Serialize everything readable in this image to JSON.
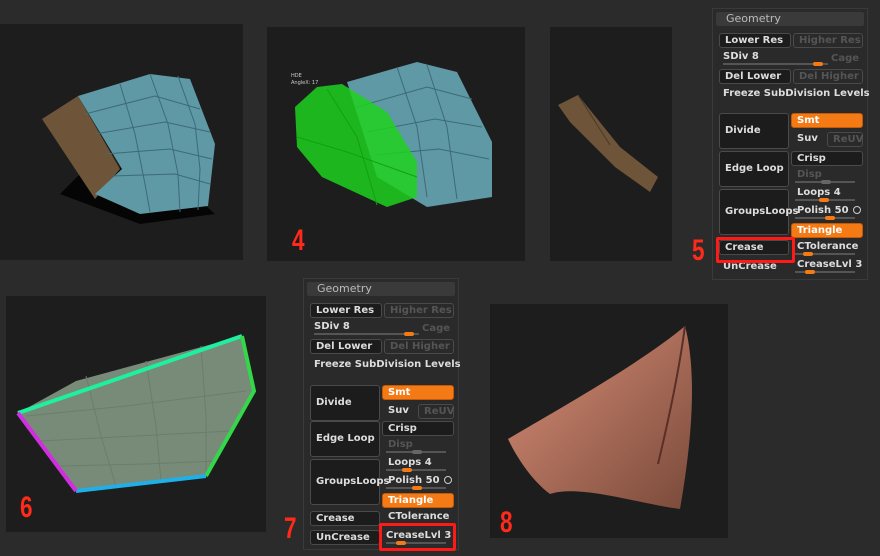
{
  "markers": {
    "n4": "4",
    "n5": "5",
    "n6": "6",
    "n7": "7",
    "n8": "8"
  },
  "overlay_text": {
    "line1": "HDE",
    "line2": "AngleX: 17"
  },
  "geometry": {
    "title": "Geometry",
    "lower_res": "Lower Res",
    "higher_res": "Higher Res",
    "sdiv": "SDiv 8",
    "cage": "Cage",
    "del_lower": "Del Lower",
    "del_higher": "Del Higher",
    "freeze": "Freeze SubDivision Levels",
    "divide": "Divide",
    "smt": "Smt",
    "suv": "Suv",
    "reuv": "ReUV",
    "edge_loop": "Edge Loop",
    "crisp": "Crisp",
    "disp": "Disp",
    "groups_loops": "GroupsLoops",
    "loops": "Loops 4",
    "polish": "Polish 50",
    "triangle": "Triangle",
    "crease": "Crease",
    "ctolerance": "CTolerance",
    "uncrease": "UnCrease",
    "crease_lvl": "CreaseLvl 3"
  },
  "colors": {
    "accent": "#f47a16",
    "highlight": "#ff1a1a"
  }
}
